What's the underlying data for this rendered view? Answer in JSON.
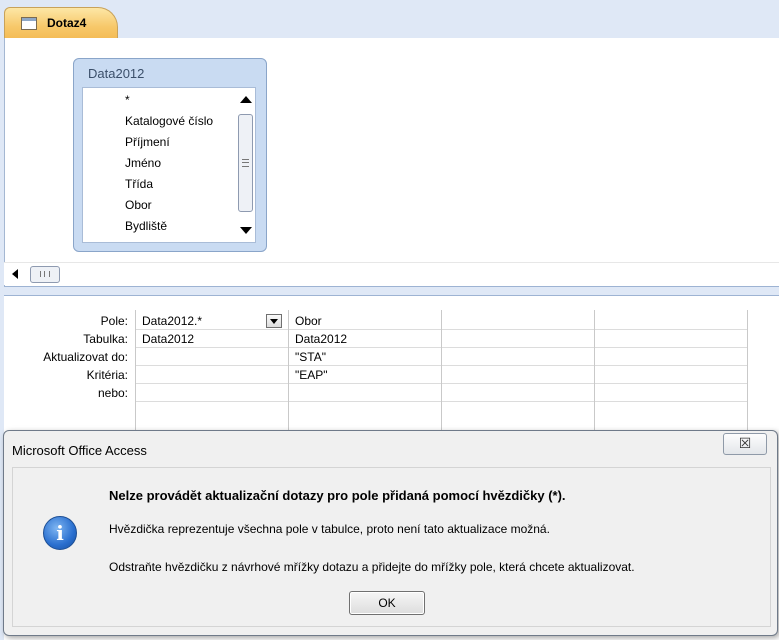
{
  "tab": {
    "label": "Dotaz4",
    "icon": "query-icon"
  },
  "field_list": {
    "title": "Data2012",
    "items": [
      "*",
      "Katalogové číslo",
      "Příjmení",
      "Jméno",
      "Třída",
      "Obor",
      "Bydliště"
    ]
  },
  "grid": {
    "row_labels": [
      "Pole:",
      "Tabulka:",
      "Aktualizovat do:",
      "Kritéria:",
      "nebo:"
    ],
    "columns": [
      {
        "pole": "Data2012.*",
        "tabulka": "Data2012",
        "aktualizovat": "",
        "kriteria": "",
        "nebo": ""
      },
      {
        "pole": "Obor",
        "tabulka": "Data2012",
        "aktualizovat": "\"STA\"",
        "kriteria": "\"EAP\"",
        "nebo": ""
      },
      {
        "pole": "",
        "tabulka": "",
        "aktualizovat": "",
        "kriteria": "",
        "nebo": ""
      },
      {
        "pole": "",
        "tabulka": "",
        "aktualizovat": "",
        "kriteria": "",
        "nebo": ""
      }
    ]
  },
  "dialog": {
    "title": "Microsoft Office Access",
    "close_glyph": "☒",
    "icon": "info-icon",
    "icon_glyph": "i",
    "heading": "Nelze provádět aktualizační dotazy pro pole přidaná pomocí hvězdičky (*).",
    "line1": "Hvězdička reprezentuje všechna pole v tabulce, proto není tato aktualizace možná.",
    "line2": "Odstraňte hvězdičku z návrhové mřížky dotazu a přidejte do mřížky pole, která chcete aktualizovat.",
    "ok_label": "OK"
  }
}
